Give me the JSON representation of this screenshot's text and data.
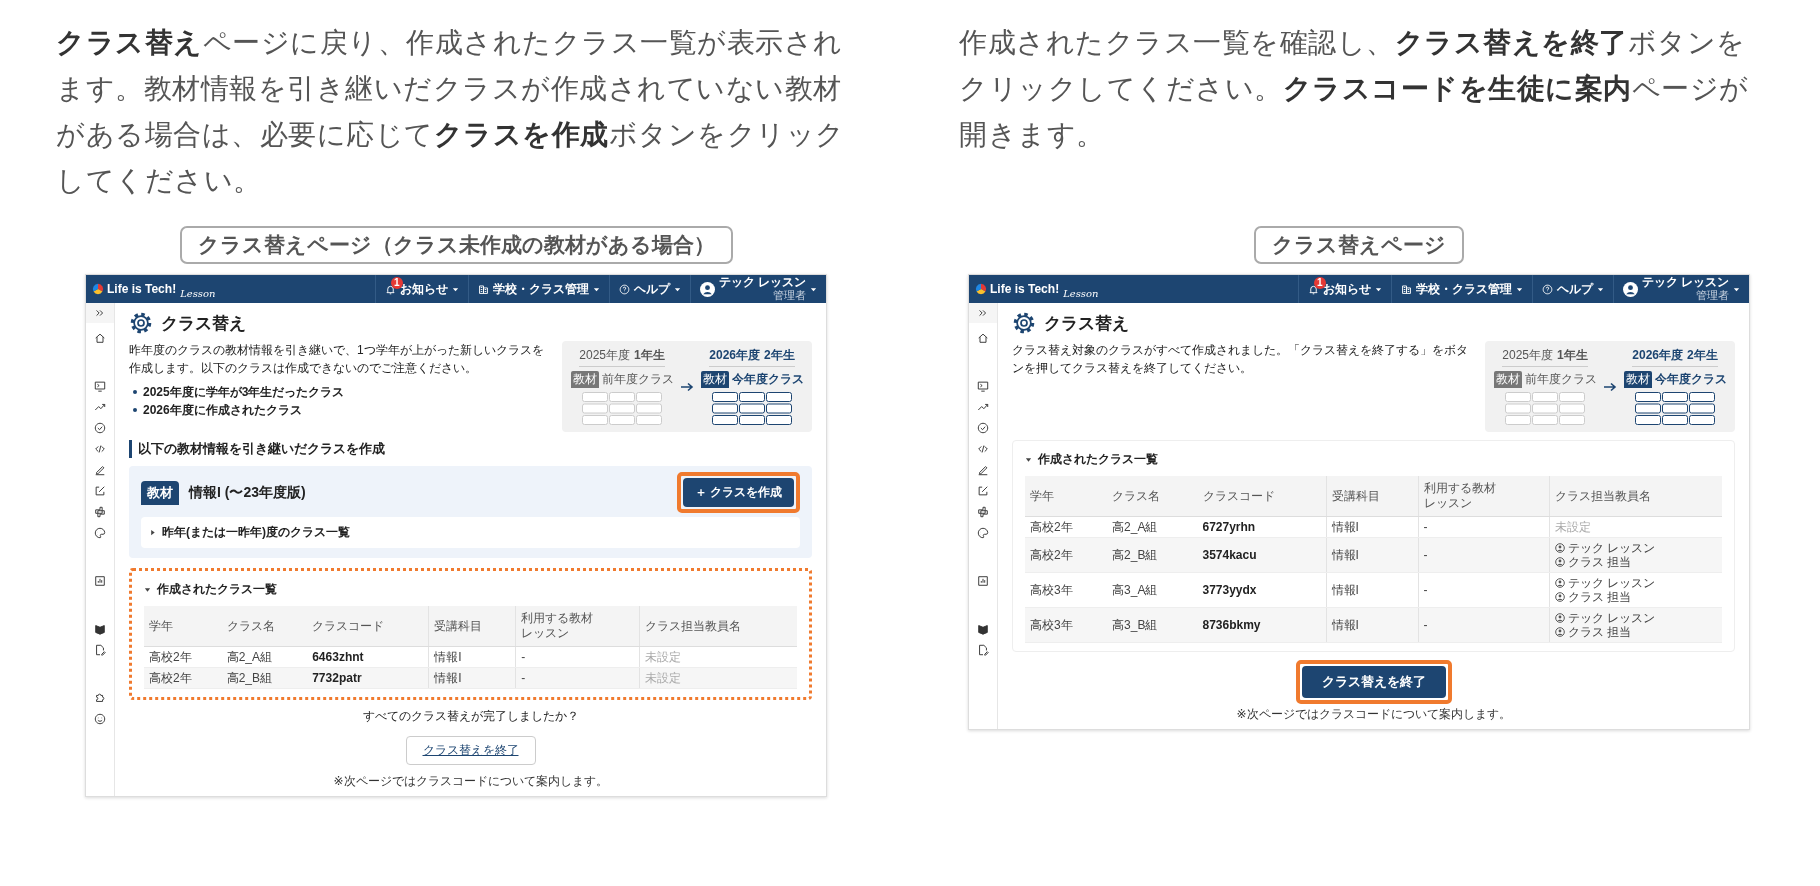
{
  "panels": [
    {
      "instruction": "**クラス替え**ページに戻り、作成されたクラス一覧が表示されます。教材情報を引き継いだクラスが作成されていない教材がある場合は、必要に応じて**クラスを作成**ボタンをクリックしてください。",
      "caption": "クラス替えページ（クラス未作成の教材がある場合）",
      "screen": {
        "navbar": {
          "logo": "Life is Tech!",
          "logo_sub": "Lesson",
          "items": [
            {
              "label": "お知らせ",
              "badge": "1"
            },
            {
              "label": "学校・クラス管理"
            },
            {
              "label": "ヘルプ"
            }
          ],
          "user": {
            "name": "テック レッスン",
            "role": "管理者"
          }
        },
        "page_title": "クラス替え",
        "description": "昨年度のクラスの教材情報を引き継いで、1つ学年が上がった新しいクラスを作成します。以下のクラスは作成できないのでご注意ください。",
        "bullets": [
          "2025年度に学年が3年生だったクラス",
          "2026年度に作成されたクラス"
        ],
        "illustration": {
          "prev_year": "2025年度",
          "prev_grade": "1年生",
          "next_year": "2026年度",
          "next_grade": "2年生",
          "prev_tag": "教材",
          "prev_label": "前年度クラス",
          "next_tag": "教材",
          "next_label": "今年度クラス"
        },
        "material_section": {
          "heading": "以下の教材情報を引き継いだクラスを作成",
          "tag": "教材",
          "name": "情報I (〜23年度版)",
          "create_button": "＋ クラスを作成",
          "highlighted": true,
          "previous_list": {
            "title": "昨年(または一昨年)度のクラス一覧",
            "expanded": false
          }
        },
        "created_list": {
          "title": "作成されたクラス一覧",
          "expanded": true,
          "highlighted": true,
          "columns": [
            "学年",
            "クラス名",
            "クラスコード",
            "受講科目",
            "利用する教材レッスン",
            "クラス担当教員名"
          ],
          "rows": [
            {
              "grade": "高校2年",
              "name": "高2_A組",
              "code": "6463zhnt",
              "subject": "情報I",
              "material": "-",
              "teacher_status": "未設定"
            },
            {
              "grade": "高校2年",
              "name": "高2_B組",
              "code": "7732patr",
              "subject": "情報I",
              "material": "-",
              "teacher_status": "未設定"
            }
          ]
        },
        "question": "すべてのクラス替えが完了しましたか？",
        "end_button": {
          "label": "クラス替えを終了",
          "kind": "link",
          "highlighted": false
        },
        "note": "※次ページではクラスコードについて案内します。"
      }
    },
    {
      "instruction": "作成されたクラス一覧を確認し、**クラス替えを終了**ボタンをクリックしてください。**クラスコードを生徒に案内**ページが開きます。",
      "caption": "クラス替えページ",
      "screen": {
        "navbar": {
          "logo": "Life is Tech!",
          "logo_sub": "Lesson",
          "items": [
            {
              "label": "お知らせ",
              "badge": "1"
            },
            {
              "label": "学校・クラス管理"
            },
            {
              "label": "ヘルプ"
            }
          ],
          "user": {
            "name": "テック レッスン",
            "role": "管理者"
          }
        },
        "page_title": "クラス替え",
        "description": "クラス替え対象のクラスがすべて作成されました。「クラス替えを終了する」をボタンを押してクラス替えを終了してください。",
        "illustration": {
          "prev_year": "2025年度",
          "prev_grade": "1年生",
          "next_year": "2026年度",
          "next_grade": "2年生",
          "prev_tag": "教材",
          "prev_label": "前年度クラス",
          "next_tag": "教材",
          "next_label": "今年度クラス"
        },
        "created_list": {
          "title": "作成されたクラス一覧",
          "expanded": true,
          "highlighted": false,
          "columns": [
            "学年",
            "クラス名",
            "クラスコード",
            "受講科目",
            "利用する教材レッスン",
            "クラス担当教員名"
          ],
          "rows": [
            {
              "grade": "高校2年",
              "name": "高2_A組",
              "code": "6727yrhn",
              "subject": "情報I",
              "material": "-",
              "teacher_status": "未設定"
            },
            {
              "grade": "高校2年",
              "name": "高2_B組",
              "code": "3574kacu",
              "subject": "情報I",
              "material": "-",
              "teachers": [
                "テック レッスン",
                "クラス 担当"
              ]
            },
            {
              "grade": "高校3年",
              "name": "高3_A組",
              "code": "3773yydx",
              "subject": "情報I",
              "material": "-",
              "teachers": [
                "テック レッスン",
                "クラス 担当"
              ]
            },
            {
              "grade": "高校3年",
              "name": "高3_B組",
              "code": "8736bkmy",
              "subject": "情報I",
              "material": "-",
              "teachers": [
                "テック レッスン",
                "クラス 担当"
              ]
            }
          ]
        },
        "end_button": {
          "label": "クラス替えを終了",
          "kind": "primary",
          "highlighted": true
        },
        "note": "※次ページではクラスコードについて案内します。"
      }
    }
  ]
}
